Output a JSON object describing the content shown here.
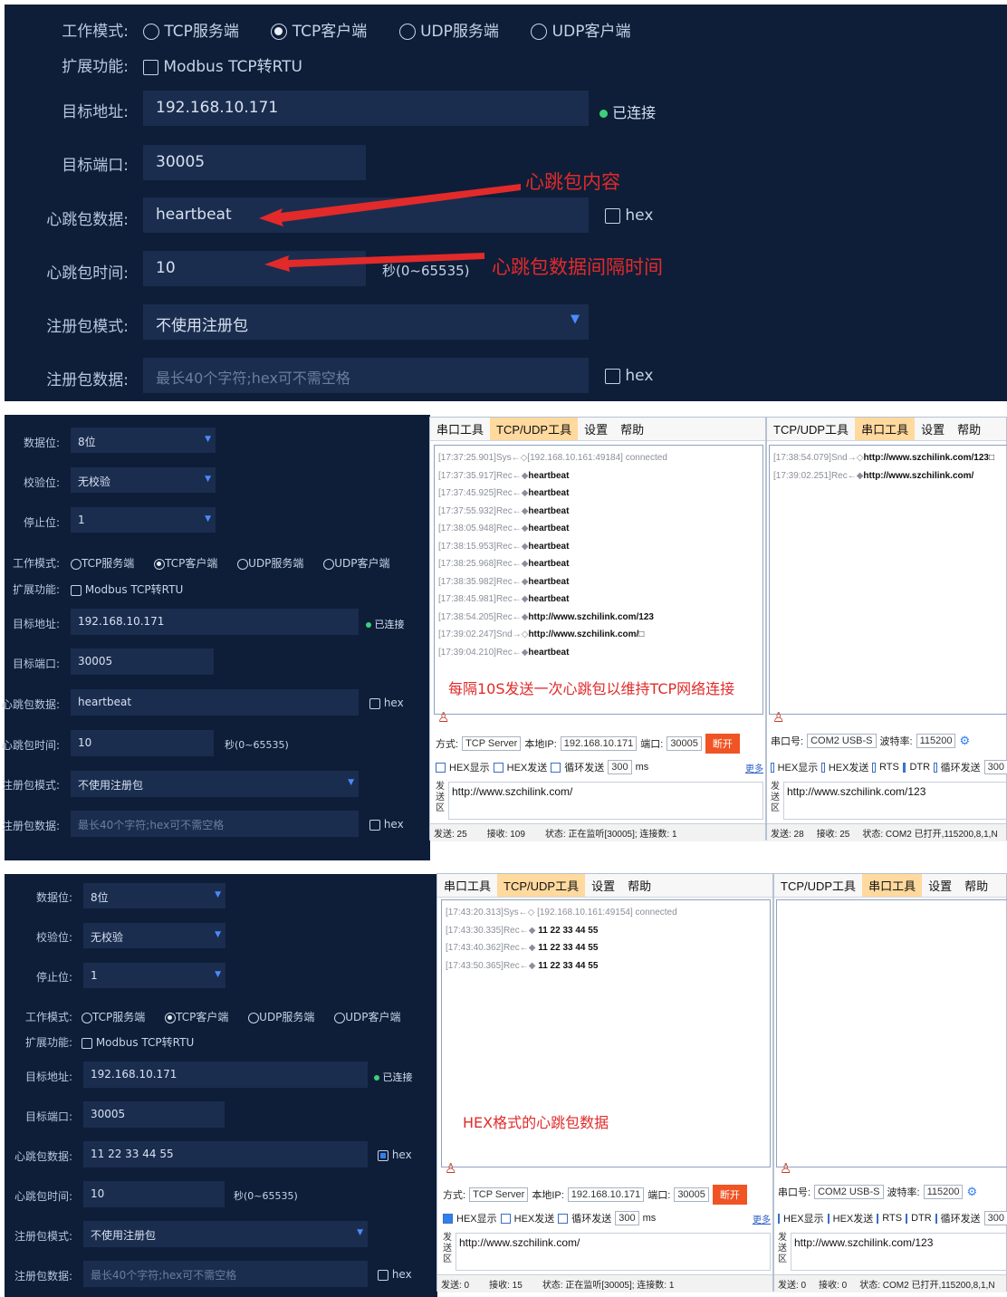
{
  "panel1": {
    "work_mode_label": "工作模式:",
    "modes": [
      "TCP服务端",
      "TCP客户端",
      "UDP服务端",
      "UDP客户端"
    ],
    "selected_mode_index": 1,
    "ext_label": "扩展功能:",
    "ext_option": "Modbus TCP转RTU",
    "addr_label": "目标地址:",
    "addr_value": "192.168.10.171",
    "status": "已连接",
    "port_label": "目标端口:",
    "port_value": "30005",
    "hb_data_label": "心跳包数据:",
    "hb_data_value": "heartbeat",
    "hex_label": "hex",
    "hb_time_label": "心跳包时间:",
    "hb_time_value": "10",
    "hb_time_unit": "秒(0~65535)",
    "reg_mode_label": "注册包模式:",
    "reg_mode_value": "不使用注册包",
    "reg_data_label": "注册包数据:",
    "reg_data_placeholder": "最长40个字符;hex可不需空格",
    "anno_content": "心跳包内容",
    "anno_interval": "心跳包数据间隔时间"
  },
  "panel2": {
    "data_bits_label": "数据位:",
    "data_bits_value": "8位",
    "parity_label": "校验位:",
    "parity_value": "无校验",
    "stop_label": "停止位:",
    "stop_value": "1",
    "work_mode_label": "工作模式:",
    "ext_label": "扩展功能:",
    "addr_label": "目标地址:",
    "addr_value": "192.168.10.171",
    "port_label": "目标端口:",
    "port_value": "30005",
    "hb_data_label": "心跳包数据:",
    "hb_data_value": "heartbeat",
    "hb_time_label": "心跳包时间:",
    "hb_time_value": "10",
    "reg_mode_label": "注册包模式:",
    "reg_mode_value": "不使用注册包",
    "reg_data_label": "注册包数据:",
    "reg_data_placeholder": "最长40个字符;hex可不需空格",
    "hex_checked": false
  },
  "panel3": {
    "hb_data_value": "11 22 33 44 55",
    "hex_checked": true
  },
  "tcp_tool": {
    "menu": [
      "串口工具",
      "TCP/UDP工具",
      "设置",
      "帮助"
    ],
    "active_menu_index": 1,
    "mode_label": "方式:",
    "mode_value": "TCP Server",
    "ip_label": "本地IP:",
    "ip_value": "192.168.10.171",
    "port_label": "端口:",
    "port_value": "30005",
    "disconnect_label": "断开",
    "hex_show": "HEX显示",
    "hex_send": "HEX发送",
    "loop_send": "循环发送",
    "loop_interval": "300",
    "ms_label": "ms",
    "more_label": "更多",
    "send_area_label": "发送区",
    "send_text": "http://www.szchilink.com/",
    "log2": [
      "[17:37:25.901]Sys←◇[192.168.10.161:49184] connected",
      "[17:37:35.917]Rec←◆heartbeat",
      "[17:37:45.925]Rec←◆heartbeat",
      "[17:37:55.932]Rec←◆heartbeat",
      "[17:38:05.948]Rec←◆heartbeat",
      "[17:38:15.953]Rec←◆heartbeat",
      "[17:38:25.968]Rec←◆heartbeat",
      "[17:38:35.982]Rec←◆heartbeat",
      "[17:38:45.981]Rec←◆heartbeat",
      "[17:38:54.205]Rec←◆http://www.szchilink.com/123",
      "[17:39:02.247]Snd→◇http://www.szchilink.com/□",
      "[17:39:04.210]Rec←◆heartbeat"
    ],
    "status2": {
      "send": "发送: 25",
      "recv": "接收: 109",
      "state": "状态: 正在监听[30005]; 连接数: 1"
    },
    "anno2": "每隔10S发送一次心跳包以维持TCP网络连接",
    "log3": [
      "[17:43:20.313]Sys←◇ [192.168.10.161:49154] connected",
      "[17:43:30.335]Rec←◆ 11 22 33 44 55",
      "[17:43:40.362]Rec←◆ 11 22 33 44 55",
      "[17:43:50.365]Rec←◆ 11 22 33 44 55"
    ],
    "status3": {
      "send": "发送: 0",
      "recv": "接收: 15",
      "state": "状态: 正在监听[30005]; 连接数: 1"
    },
    "anno3": "HEX格式的心跳包数据"
  },
  "com_tool": {
    "menu": [
      "TCP/UDP工具",
      "串口工具",
      "设置",
      "帮助"
    ],
    "active_menu_index": 1,
    "port_label": "串口号:",
    "port_value": "COM2 USB-S",
    "baud_label": "波特率:",
    "baud_value": "115200",
    "hex_show": "HEX显示",
    "hex_send": "HEX发送",
    "rts": "RTS",
    "dtr": "DTR",
    "loop_send": "循环发送",
    "loop_interval": "300",
    "send_area_label": "发送区",
    "send_text": "http://www.szchilink.com/123",
    "log2": [
      "[17:38:54.079]Snd→◇http://www.szchilink.com/123□",
      "[17:39:02.251]Rec←◆http://www.szchilink.com/"
    ],
    "status2": {
      "send": "发送: 28",
      "recv": "接收: 25",
      "state": "状态: COM2 已打开,115200,8,1,N"
    },
    "status3": {
      "send": "发送: 0",
      "recv": "接收: 0",
      "state": "状态: COM2 已打开,115200,8,1,N"
    }
  },
  "colors": {
    "bg": "#0e1e38",
    "field": "#1b2d4e",
    "accent": "#2f7ff0",
    "status": "#3ad17a",
    "annotation": "#e22a2a",
    "disconnect": "#f05424"
  }
}
